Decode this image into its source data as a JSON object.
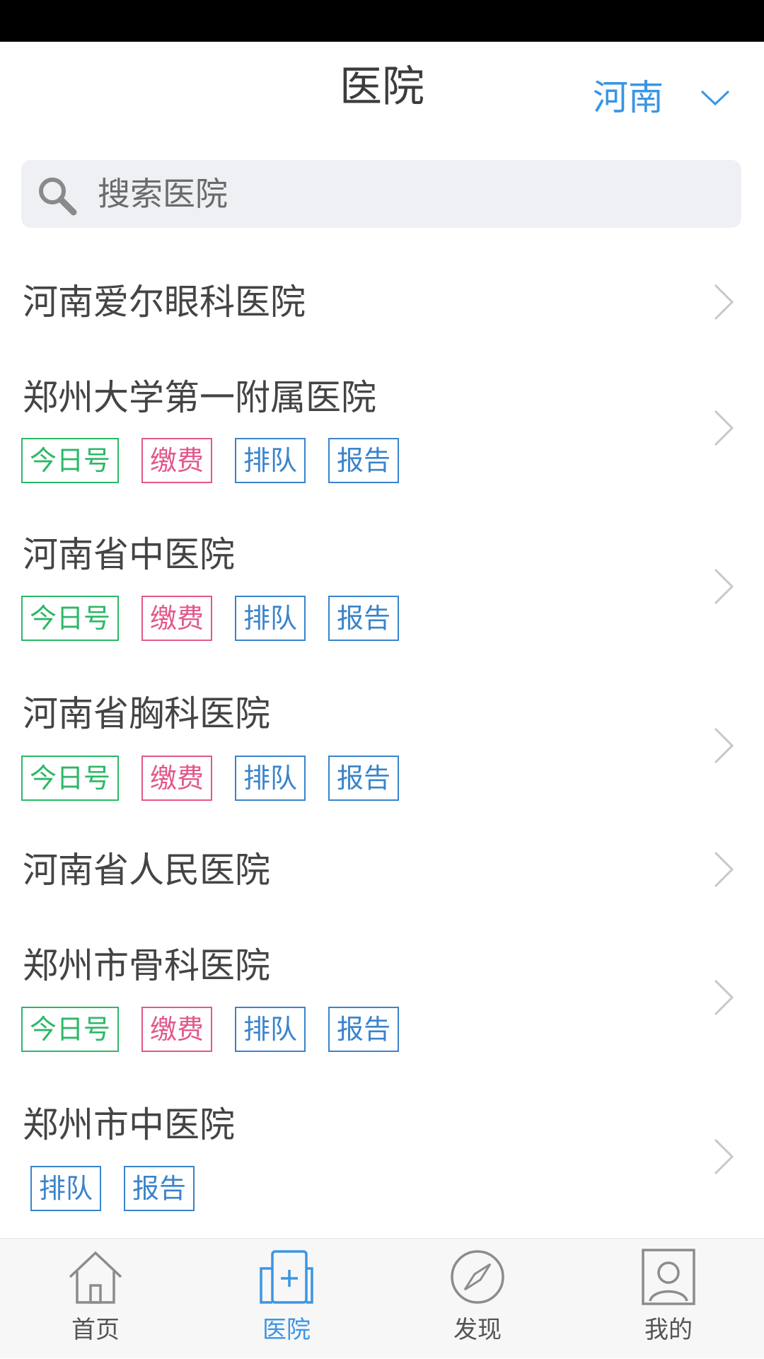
{
  "header": {
    "title": "医院",
    "region": "河南"
  },
  "search": {
    "placeholder": "搜索医院"
  },
  "hospitals": [
    {
      "name": "河南爱尔眼科医院",
      "tags": []
    },
    {
      "name": "郑州大学第一附属医院",
      "tags": [
        "今日号",
        "缴费",
        "排队",
        "报告"
      ]
    },
    {
      "name": "河南省中医院",
      "tags": [
        "今日号",
        "缴费",
        "排队",
        "报告"
      ]
    },
    {
      "name": "河南省胸科医院",
      "tags": [
        "今日号",
        "缴费",
        "排队",
        "报告"
      ]
    },
    {
      "name": "河南省人民医院",
      "tags": []
    },
    {
      "name": "郑州市骨科医院",
      "tags": [
        "今日号",
        "缴费",
        "排队",
        "报告"
      ]
    },
    {
      "name": "郑州市中医院",
      "tags": [
        "排队",
        "报告"
      ]
    }
  ],
  "tabbar": {
    "items": [
      {
        "label": "首页",
        "icon": "home-icon"
      },
      {
        "label": "医院",
        "icon": "hospital-icon",
        "active": true
      },
      {
        "label": "发现",
        "icon": "compass-icon"
      },
      {
        "label": "我的",
        "icon": "profile-icon"
      }
    ]
  },
  "colors": {
    "accent": "#3b95e4",
    "tag_green": "#2cb867",
    "tag_pink": "#e2588c",
    "tag_blue": "#3a84cc"
  }
}
